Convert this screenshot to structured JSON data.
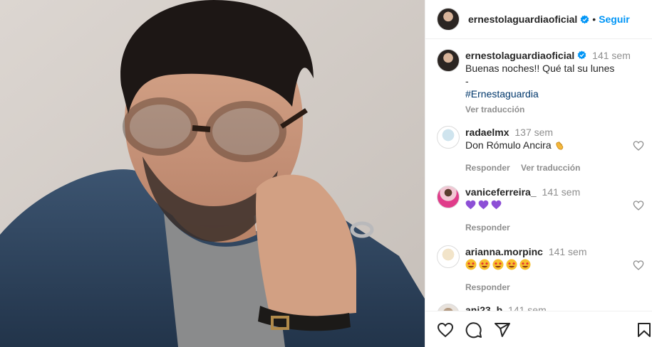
{
  "post": {
    "author": "ernestolaguardiaoficial",
    "follow_label": "Seguir",
    "dot": "•",
    "more_label": "···"
  },
  "caption": {
    "author": "ernestolaguardiaoficial",
    "time": "141 sem",
    "line1": "Buenas noches!! Qué tal su lunes",
    "line2": "-",
    "hashtag": "#Ernestaguardia",
    "translate_label": "Ver traducción"
  },
  "comments": [
    {
      "user": "radaelmx",
      "time": "137 sem",
      "text": "Don Rómulo Ancira",
      "emoji": "clapping-hands",
      "reply_label": "Responder",
      "translate_label": "Ver traducción"
    },
    {
      "user": "vaniceferreira_",
      "time": "141 sem",
      "emoji": "purple-heart x3",
      "reply_label": "Responder"
    },
    {
      "user": "arianna.morpinc",
      "time": "141 sem",
      "emoji": "star-struck x5",
      "reply_label": "Responder"
    },
    {
      "user": "ani23_b",
      "time": "141 sem"
    }
  ],
  "colors": {
    "link": "#0095f6",
    "muted": "#8e8e8e",
    "hashtag": "#00376b",
    "verified": "#0095f6"
  },
  "icons": [
    "verified-badge-icon",
    "heart-icon",
    "comment-icon",
    "share-icon",
    "bookmark-icon"
  ]
}
